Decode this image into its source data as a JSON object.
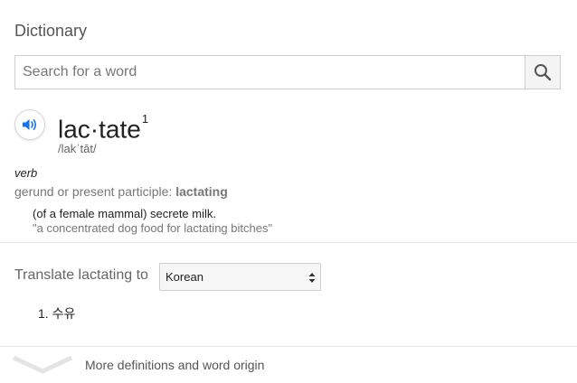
{
  "dictionary": {
    "heading": "Dictionary",
    "search": {
      "placeholder": "Search for a word",
      "value": ""
    },
    "icons": {
      "search": "search-icon",
      "speaker": "speaker-icon",
      "expand": "chevron-down-icon"
    },
    "entry": {
      "word": "lac·tate",
      "homograph_number": "1",
      "phonetic": "/lakˈtāt/",
      "part_of_speech": "verb",
      "forms_label": "gerund or present participle:",
      "forms_value": "lactating",
      "definition": "(of a female mammal) secrete milk.",
      "example": "\"a concentrated dog food for lactating bitches\""
    },
    "translate": {
      "label": "Translate lactating to",
      "language": "Korean",
      "results": [
        "1. 수유"
      ]
    },
    "more_link": "More definitions and word origin",
    "colors": {
      "accent": "#1a73e8",
      "muted_text": "#777777",
      "divider": "#e6e6e6"
    }
  }
}
